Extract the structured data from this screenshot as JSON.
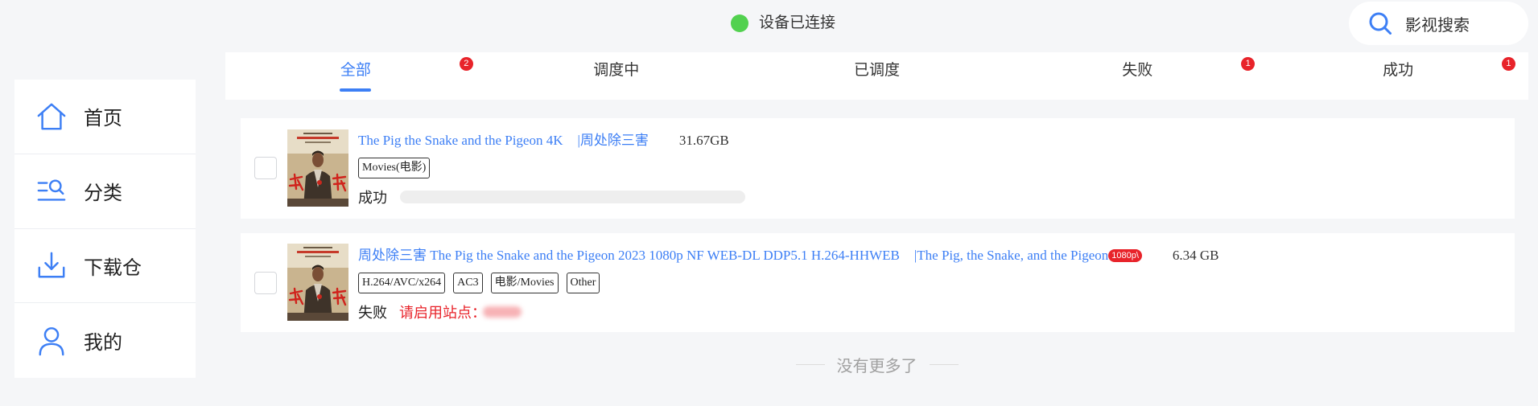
{
  "colors": {
    "accent": "#3d7ff5",
    "danger": "#e8232a",
    "connected": "#52d14f"
  },
  "status": {
    "text": "设备已连接",
    "icon": "connected-dot"
  },
  "search": {
    "label": "影视搜索",
    "icon": "search-icon"
  },
  "sidebar": {
    "items": [
      {
        "label": "首页",
        "icon": "home-icon"
      },
      {
        "label": "分类",
        "icon": "category-search-icon"
      },
      {
        "label": "下载仓",
        "icon": "download-icon"
      },
      {
        "label": "我的",
        "icon": "user-icon"
      }
    ]
  },
  "tabs": {
    "items": [
      {
        "label": "全部",
        "active": true,
        "badge": "2"
      },
      {
        "label": "调度中"
      },
      {
        "label": "已调度"
      },
      {
        "label": "失败",
        "badge": "1"
      },
      {
        "label": "成功",
        "badge": "1"
      }
    ]
  },
  "tasks": [
    {
      "title": "The Pig the Snake and the Pigeon 4K",
      "subtitle": "|周处除三害",
      "size": "31.67GB",
      "tags": [
        "Movies(电影)"
      ],
      "status": "成功",
      "progress": 0,
      "checked": false
    },
    {
      "title": "周处除三害 The Pig the Snake and the Pigeon 2023 1080p NF WEB-DL DDP5.1 H.264-HHWEB",
      "subtitle": "|The Pig, the Snake, and the Pigeon",
      "resolution_badge": "1080p\\",
      "size": "6.34 GB",
      "tags": [
        "H.264/AVC/x264",
        "AC3",
        "电影/Movies",
        "Other"
      ],
      "status": "失败",
      "error": "请启用站点：",
      "checked": false
    }
  ],
  "footer": {
    "text": "没有更多了"
  }
}
